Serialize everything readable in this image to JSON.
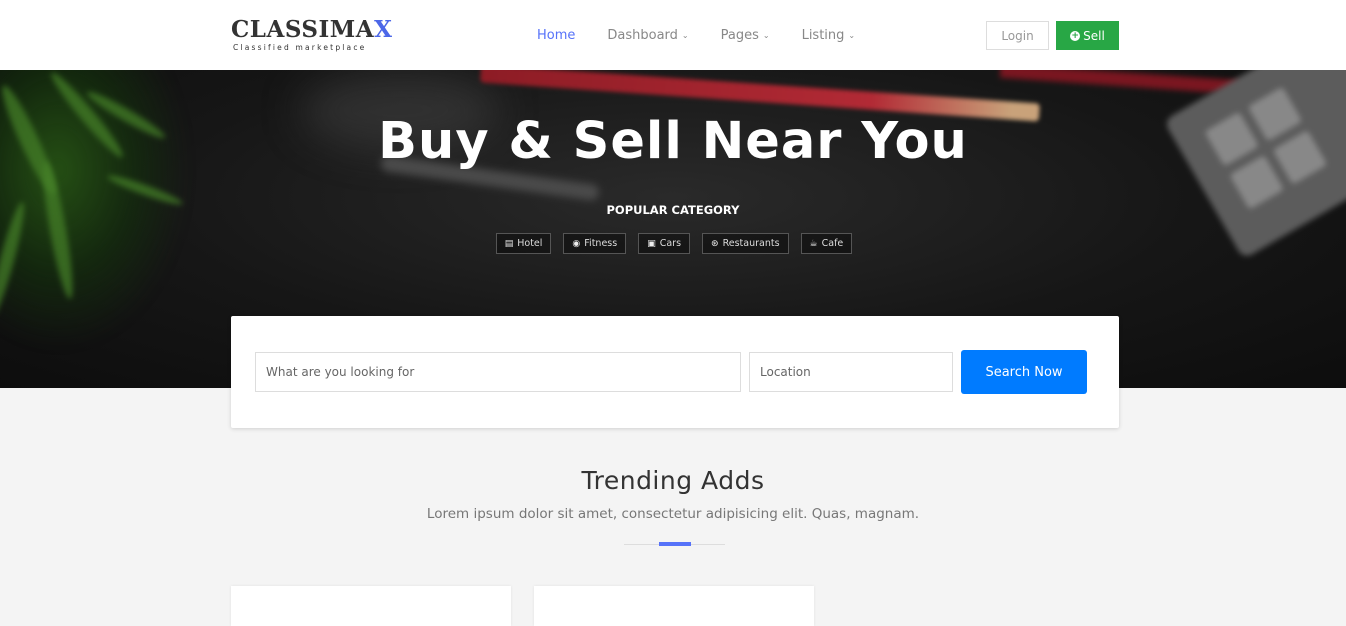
{
  "brand": {
    "name_main": "CLASSIMA",
    "name_accent": "X",
    "tagline": "Classified marketplace"
  },
  "nav": {
    "items": [
      {
        "label": "Home",
        "active": true,
        "dropdown": false
      },
      {
        "label": "Dashboard",
        "active": false,
        "dropdown": true
      },
      {
        "label": "Pages",
        "active": false,
        "dropdown": true
      },
      {
        "label": "Listing",
        "active": false,
        "dropdown": true
      }
    ],
    "login_label": "Login",
    "sell_label": "Sell"
  },
  "hero": {
    "title": "Buy & Sell Near You",
    "popular_label": "POPULAR CATEGORY",
    "categories": [
      {
        "label": "Hotel",
        "icon": "bed-icon"
      },
      {
        "label": "Fitness",
        "icon": "compass-icon"
      },
      {
        "label": "Cars",
        "icon": "car-icon"
      },
      {
        "label": "Restaurants",
        "icon": "cutlery-icon"
      },
      {
        "label": "Cafe",
        "icon": "coffee-icon"
      }
    ]
  },
  "search": {
    "query_placeholder": "What are you looking for",
    "location_placeholder": "Location",
    "button_label": "Search Now"
  },
  "trending": {
    "title": "Trending Adds",
    "subtitle": "Lorem ipsum dolor sit amet, consectetur adipisicing elit. Quas, magnam."
  },
  "colors": {
    "accent": "#5672f9",
    "sell_green": "#28a745",
    "search_blue": "#007bff"
  }
}
